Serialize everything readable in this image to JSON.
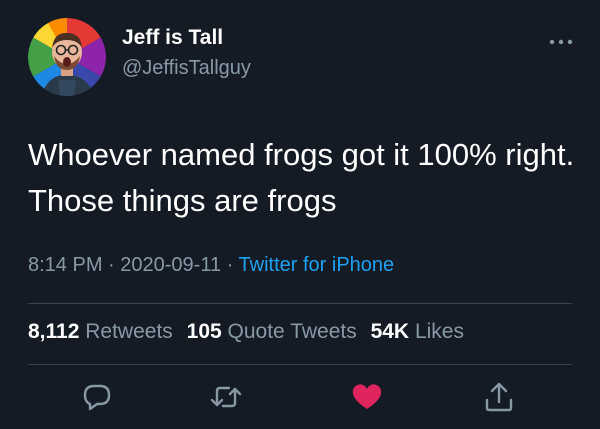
{
  "user": {
    "display_name": "Jeff is Tall",
    "handle": "@JeffisTallguy",
    "avatar": "profile-avatar"
  },
  "tweet": {
    "text": "Whoever named frogs got it 100% right. Those things are frogs",
    "time": "8:14 PM",
    "date": "2020-09-11",
    "separator": "·",
    "source": "Twitter for iPhone"
  },
  "stats": {
    "retweets_count": "8,112",
    "retweets_label": "Retweets",
    "quotes_count": "105",
    "quotes_label": "Quote Tweets",
    "likes_count": "54K",
    "likes_label": "Likes"
  },
  "actions": {
    "reply_icon": "reply-icon",
    "retweet_icon": "retweet-icon",
    "like_icon": "heart-icon",
    "share_icon": "share-icon"
  },
  "colors": {
    "background": "#151b24",
    "secondary_text": "#8899a6",
    "link": "#1da1f2",
    "like": "#e0245e"
  }
}
